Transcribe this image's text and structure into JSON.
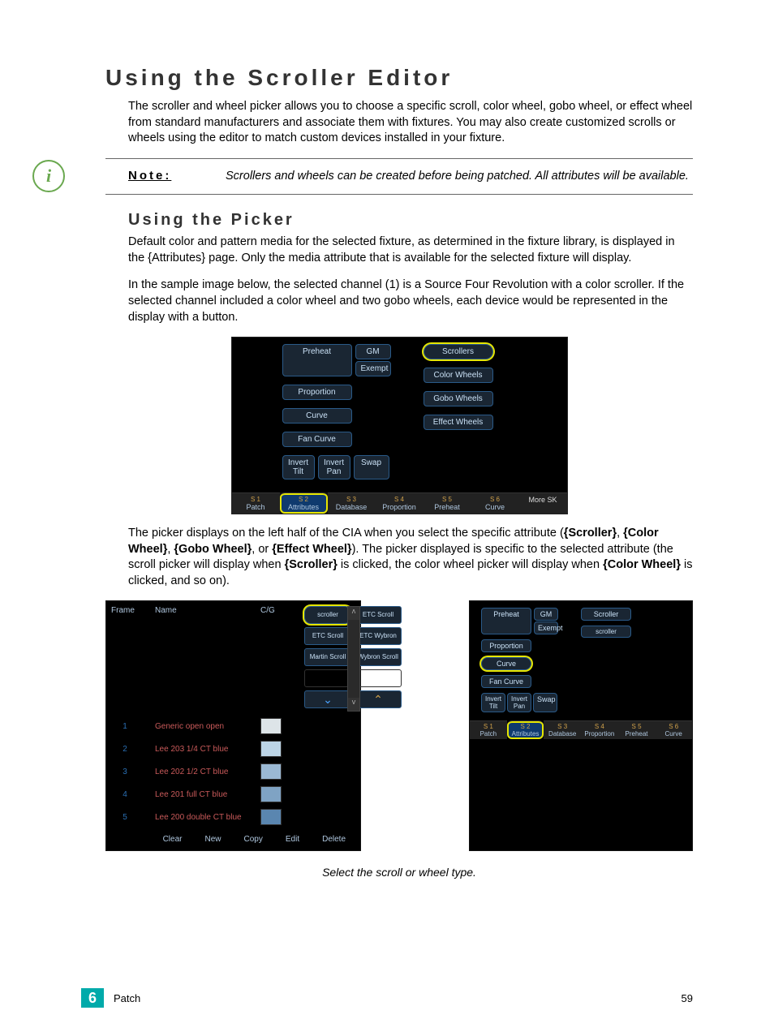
{
  "title": "Using the Scroller Editor",
  "intro": "The scroller and wheel picker allows you to choose a specific scroll, color wheel, gobo wheel, or effect wheel from standard manufacturers and associate them with fixtures. You may also create customized scrolls or wheels using the editor to match custom devices installed in your fixture.",
  "note": {
    "label": "Note:",
    "text": "Scrollers and wheels can be created before being patched. All attributes will be available."
  },
  "sub1": "Using the Picker",
  "p2": "Default color and pattern media for the selected fixture, as determined in the fixture library, is displayed in the {Attributes} page. Only the media attribute that is available for the selected fixture will display.",
  "p3": "In the sample image below, the selected channel (1) is a Source Four Revolution with a color scroller. If the selected channel included a color wheel and two gobo wheels, each device would be represented in the display with a button.",
  "fig1": {
    "left": {
      "preheat": "Preheat",
      "gm": "GM",
      "exempt": "Exempt",
      "proportion": "Proportion",
      "curve": "Curve",
      "fancurve": "Fan Curve",
      "invert_tilt": "Invert Tilt",
      "invert_pan": "Invert Pan",
      "swap": "Swap"
    },
    "right": {
      "scrollers": "Scrollers",
      "color_wheels": "Color Wheels",
      "gobo_wheels": "Gobo Wheels",
      "effect_wheels": "Effect Wheels"
    },
    "tabs": {
      "s1": {
        "num": "S 1",
        "lbl": "Patch"
      },
      "s2": {
        "num": "S 2",
        "lbl": "Attributes"
      },
      "s3": {
        "num": "S 3",
        "lbl": "Database"
      },
      "s4": {
        "num": "S 4",
        "lbl": "Proportion"
      },
      "s5": {
        "num": "S 5",
        "lbl": "Preheat"
      },
      "s6": {
        "num": "S 6",
        "lbl": "Curve"
      },
      "more": "More SK"
    }
  },
  "p4_a": "The picker displays on the left half of the CIA when you select the specific attribute (",
  "p4_b": "{Scroller}",
  "p4_c": ", ",
  "p4_d": "{Color Wheel}",
  "p4_e": ", ",
  "p4_f": "{Gobo Wheel}",
  "p4_g": ", or ",
  "p4_h": "{Effect Wheel}",
  "p4_i": "). The picker displayed is specific to the selected attribute (the scroll picker will display when ",
  "p4_j": "{Scroller}",
  "p4_k": " is clicked, the color wheel picker will display when ",
  "p4_l": "{Color Wheel}",
  "p4_m": " is clicked, and so on).",
  "fig2": {
    "head": {
      "frame": "Frame",
      "name": "Name",
      "cg": "C/G"
    },
    "rows": [
      {
        "n": "1",
        "nm": "Generic open open"
      },
      {
        "n": "2",
        "nm": "Lee 203 1/4 CT blue"
      },
      {
        "n": "3",
        "nm": "Lee 202 1/2 CT blue"
      },
      {
        "n": "4",
        "nm": "Lee 201 full CT blue"
      },
      {
        "n": "5",
        "nm": "Lee 200 double CT blue"
      }
    ],
    "grid": [
      "scroller",
      "ETC Scroll",
      "ETC Scroll",
      "ETC Wybron",
      "Martin Scroll",
      "Wybron Scroll"
    ],
    "bottom": {
      "clear": "Clear",
      "new": "New",
      "copy": "Copy",
      "edit": "Edit",
      "delete": "Delete"
    }
  },
  "fig3": {
    "left": {
      "preheat": "Preheat",
      "gm": "GM",
      "exempt": "Exempt",
      "proportion": "Proportion",
      "curve": "Curve",
      "fancurve": "Fan Curve",
      "invert_tilt": "Invert Tilt",
      "invert_pan": "Invert Pan",
      "swap": "Swap"
    },
    "right": {
      "scroller": "Scroller",
      "scroller2": "scroller"
    },
    "tabs": {
      "s1": {
        "num": "S 1",
        "lbl": "Patch"
      },
      "s2": {
        "num": "S 2",
        "lbl": "Attributes"
      },
      "s3": {
        "num": "S 3",
        "lbl": "Database"
      },
      "s4": {
        "num": "S 4",
        "lbl": "Proportion"
      },
      "s5": {
        "num": "S 5",
        "lbl": "Preheat"
      },
      "s6": {
        "num": "S 6",
        "lbl": "Curve"
      }
    }
  },
  "caption": "Select the scroll or wheel type.",
  "footer": {
    "chapter": "6",
    "name": "Patch",
    "page": "59"
  }
}
